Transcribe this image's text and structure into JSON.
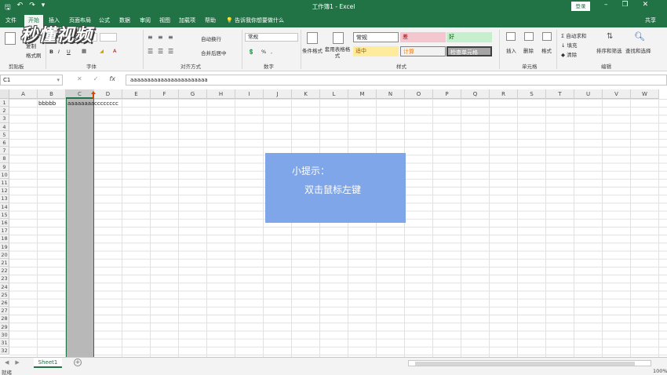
{
  "app": {
    "window_title": "工作簿1 - Excel",
    "login_label": "登录",
    "share_label": "共享"
  },
  "tabs": [
    "文件",
    "开始",
    "插入",
    "页面布局",
    "公式",
    "数据",
    "审阅",
    "视图",
    "加载项",
    "帮助"
  ],
  "active_tab": "开始",
  "tell_me": "告诉我你想要做什么",
  "ribbon": {
    "clipboard": {
      "label": "剪贴板",
      "paste": "粘贴",
      "cut": "剪切",
      "copy": "复制",
      "format_painter": "格式刷"
    },
    "font": {
      "label": "字体",
      "bold": "B",
      "italic": "I",
      "underline": "U"
    },
    "alignment": {
      "label": "对齐方式",
      "wrap": "自动换行",
      "merge": "合并后居中"
    },
    "number": {
      "label": "数字",
      "format": "常规",
      "percent": "%"
    },
    "styles": {
      "label": "样式",
      "conditional": "条件格式",
      "table": "套用表格格式",
      "cells": [
        {
          "name": "常规",
          "bg": "#ffffff",
          "fg": "#222222"
        },
        {
          "name": "差",
          "bg": "#f4c7ce",
          "fg": "#9c0006"
        },
        {
          "name": "好",
          "bg": "#c6efce",
          "fg": "#006100"
        },
        {
          "name": "适中",
          "bg": "#ffeb9c",
          "fg": "#9c5700"
        },
        {
          "name": "计算",
          "bg": "#f2f2f2",
          "fg": "#fa7d00"
        },
        {
          "name": "检查单元格",
          "bg": "#a5a5a5",
          "fg": "#ffffff"
        }
      ]
    },
    "cells_group": {
      "label": "单元格",
      "insert": "插入",
      "delete": "删除",
      "format": "格式"
    },
    "editing": {
      "label": "编辑",
      "autosum": "自动求和",
      "fill": "填充",
      "clear": "清除",
      "sort": "排序和筛选",
      "find": "查找和选择"
    }
  },
  "formula_bar": {
    "name_box": "C1",
    "fx": "fx",
    "content": "aaaaaaaaaaaaaaaaaaaaaaa"
  },
  "grid": {
    "columns": [
      "A",
      "B",
      "C",
      "D",
      "E",
      "F",
      "G",
      "H",
      "I",
      "J",
      "K",
      "L",
      "M",
      "N",
      "O",
      "P",
      "Q",
      "R",
      "S",
      "T",
      "U",
      "V",
      "W"
    ],
    "selected_column": "C",
    "rows": [
      "1",
      "2",
      "3",
      "4",
      "5",
      "6",
      "7",
      "8",
      "9",
      "10",
      "11",
      "12",
      "13",
      "14",
      "15",
      "16",
      "17",
      "18",
      "19",
      "20",
      "21",
      "22",
      "23",
      "24",
      "25",
      "26",
      "27",
      "28",
      "29",
      "30",
      "31",
      "32"
    ],
    "cells": {
      "B1": "bbbbb",
      "C1": "aaaaaaaa",
      "D1": "cccccccc"
    }
  },
  "tip": {
    "title": "小提示：",
    "body": "双击鼠标左键"
  },
  "watermark": "秒懂视频",
  "sheets": [
    "Sheet1"
  ],
  "status": {
    "ready": "就绪",
    "zoom": "100%"
  },
  "colors": {
    "excel_green": "#217346",
    "tip_bg": "#7ea6e8"
  }
}
